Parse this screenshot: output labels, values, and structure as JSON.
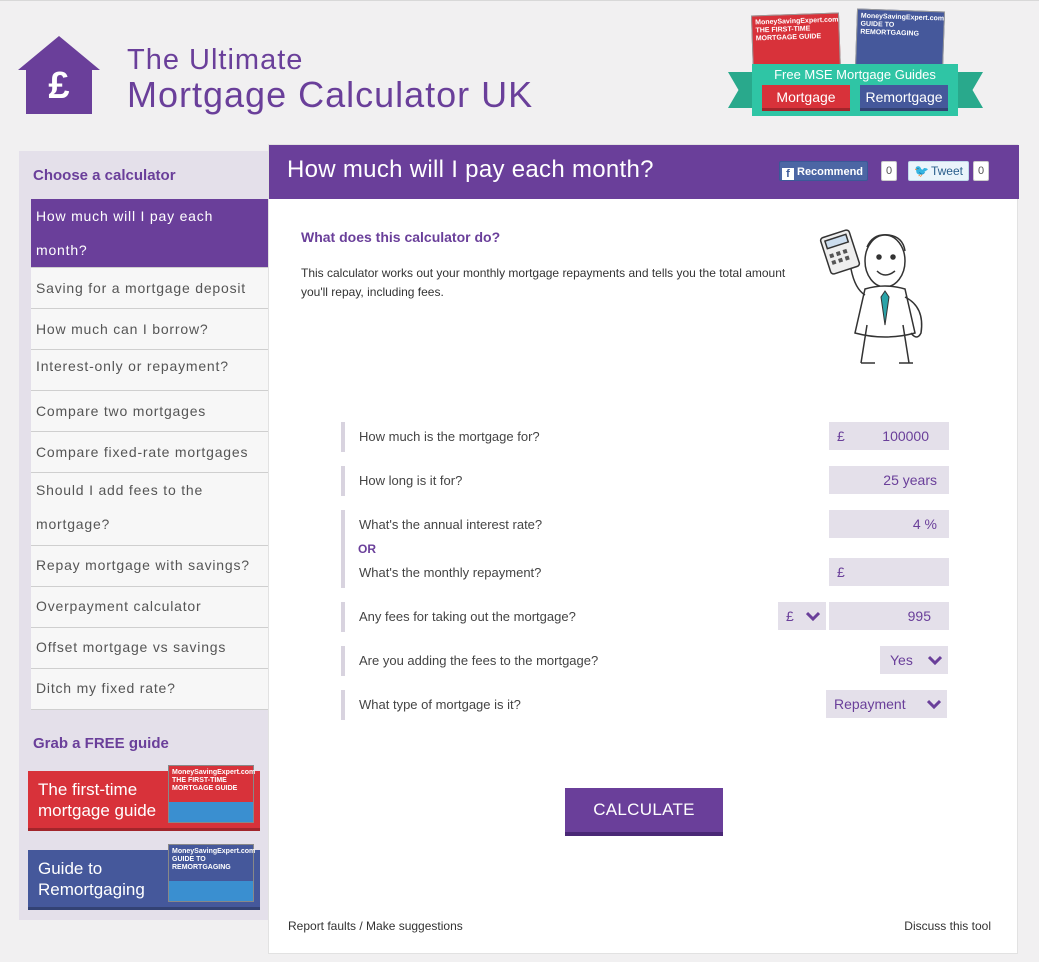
{
  "header": {
    "title_line1": "The Ultimate",
    "title_line2": "Mortgage Calculator UK"
  },
  "promo": {
    "book1": "THE FIRST-TIME MORTGAGE GUIDE",
    "book2": "GUIDE TO REMORTGAGING",
    "book_brand": "MoneySavingExpert.com",
    "label": "Free MSE Mortgage Guides",
    "mortgage_button": "Mortgage",
    "remortgage_button": "Remortgage"
  },
  "sidebar": {
    "heading": "Choose a calculator",
    "items": [
      {
        "label": "How much will I pay each month?"
      },
      {
        "label": "Saving for a mortgage deposit"
      },
      {
        "label": "How much can I borrow?"
      },
      {
        "label": "Interest-only or repayment?"
      },
      {
        "label": "Compare two mortgages"
      },
      {
        "label": "Compare fixed-rate mortgages"
      },
      {
        "label": "Should I add fees to the mortgage?"
      },
      {
        "label": "Repay mortgage with savings?"
      },
      {
        "label": "Overpayment calculator"
      },
      {
        "label": "Offset mortgage vs savings"
      },
      {
        "label": "Ditch my fixed rate?"
      }
    ],
    "guide_heading": "Grab a FREE guide",
    "guide1": "The first-time mortgage guide",
    "guide2": "Guide to Remortgaging"
  },
  "main": {
    "title": "How much will I pay each month?",
    "fb_label": "Recommend",
    "fb_count": "0",
    "tweet_label": "Tweet",
    "tweet_count": "0",
    "question_heading": "What does this calculator do?",
    "description": "This calculator works out your monthly mortgage repayments and tells you the total amount you'll repay, including fees.",
    "form": {
      "amount_label": "How much is the mortgage for?",
      "amount_prefix": "£",
      "amount_value": "100000",
      "term_label": "How long is it for?",
      "term_value": "25 years",
      "rate_label": "What's the annual interest rate?",
      "rate_value": "4 %",
      "or_label": "OR",
      "repayment_label": "What's the monthly repayment?",
      "repayment_prefix": "£",
      "fees_label": "Any fees for taking out the mortgage?",
      "fees_unit": "£",
      "fees_value": "995",
      "add_fees_label": "Are you adding the fees to the mortgage?",
      "add_fees_value": "Yes",
      "type_label": "What type of mortgage is it?",
      "type_value": "Repayment"
    },
    "calculate_button": "CALCULATE",
    "report_link": "Report faults / Make suggestions",
    "discuss_link": "Discuss this tool"
  },
  "colors": {
    "brand_purple": "#6a3f9a",
    "red": "#d8323a",
    "blue": "#45589b",
    "teal": "#2fc5a5"
  }
}
